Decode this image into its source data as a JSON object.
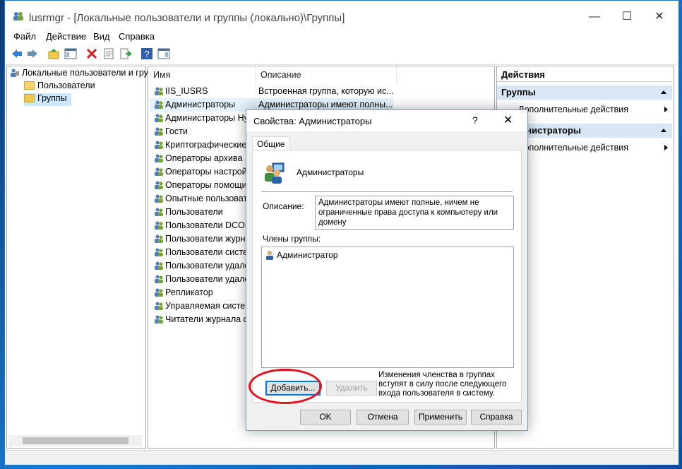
{
  "window": {
    "title": "lusrmgr - [Локальные пользователи и группы (локально)\\Группы]",
    "minimize": "—",
    "maximize": "☐",
    "close": "✕"
  },
  "menu": [
    "Файл",
    "Действие",
    "Вид",
    "Справка"
  ],
  "tree": {
    "root": "Локальные пользователи и гру",
    "users": "Пользователи",
    "groups": "Группы"
  },
  "list": {
    "columns": {
      "name": "Имя",
      "description": "Описание"
    },
    "rows": [
      {
        "name": "IIS_IUSRS",
        "desc": "Встроенная группа, которую ис..."
      },
      {
        "name": "Администраторы",
        "desc": "Администраторы имеют полны..."
      },
      {
        "name": "Администраторы Hy",
        "desc": ""
      },
      {
        "name": "Гости",
        "desc": ""
      },
      {
        "name": "Криптографические",
        "desc": ""
      },
      {
        "name": "Операторы архива",
        "desc": ""
      },
      {
        "name": "Операторы настройк",
        "desc": ""
      },
      {
        "name": "Операторы помощи",
        "desc": ""
      },
      {
        "name": "Опытные пользовате",
        "desc": ""
      },
      {
        "name": "Пользователи",
        "desc": ""
      },
      {
        "name": "Пользователи DCOM",
        "desc": ""
      },
      {
        "name": "Пользователи журна",
        "desc": ""
      },
      {
        "name": "Пользователи систе.",
        "desc": ""
      },
      {
        "name": "Пользователи удале.",
        "desc": ""
      },
      {
        "name": "Пользователи удале.",
        "desc": ""
      },
      {
        "name": "Репликатор",
        "desc": ""
      },
      {
        "name": "Управляемая систем",
        "desc": ""
      },
      {
        "name": "Читатели журнала с.",
        "desc": ""
      }
    ]
  },
  "actions": {
    "header": "Действия",
    "section1": "Группы",
    "item1": "Дополнительные действия",
    "section2": "Администраторы",
    "item2": "Дополнительные действия"
  },
  "dialog": {
    "title": "Свойства: Администраторы",
    "help": "?",
    "close": "✕",
    "tab": "Общие",
    "group_name": "Администраторы",
    "description_label": "Описание:",
    "description": "Администраторы имеют полные, ничем не ограниченные права доступа к компьютеру или домену",
    "members_label": "Члены группы:",
    "members": [
      "Администратор"
    ],
    "add": "Добавить...",
    "remove": "Удалить",
    "note": "Изменения членства в группах вступят в силу после следующего входа пользователя в систему.",
    "ok": "OK",
    "cancel": "Отмена",
    "apply": "Применить",
    "help_btn": "Справка"
  },
  "colors": {
    "accent": "#0078d7",
    "highlight": "#e2101c",
    "selection": "#e5f1fb"
  }
}
